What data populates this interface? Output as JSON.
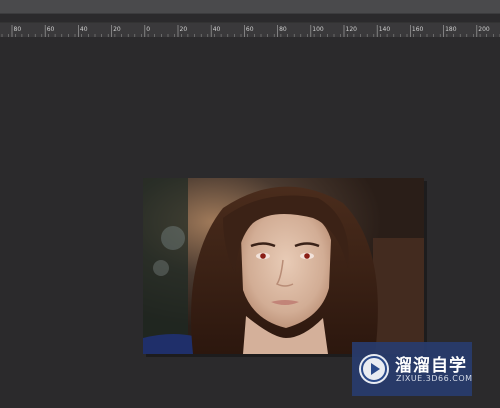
{
  "ruler": {
    "labels": [
      "80",
      "60",
      "40",
      "20",
      "0",
      "20",
      "40",
      "60",
      "80",
      "100",
      "120",
      "140",
      "160",
      "180",
      "200"
    ]
  },
  "watermark": {
    "title": "溜溜自学",
    "subtitle": "ZIXUE.3D66.COM"
  },
  "colors": {
    "workspace": "#2b2a2c",
    "ruler": "#3a393b",
    "watermark_bg": "#2b4a8a"
  }
}
